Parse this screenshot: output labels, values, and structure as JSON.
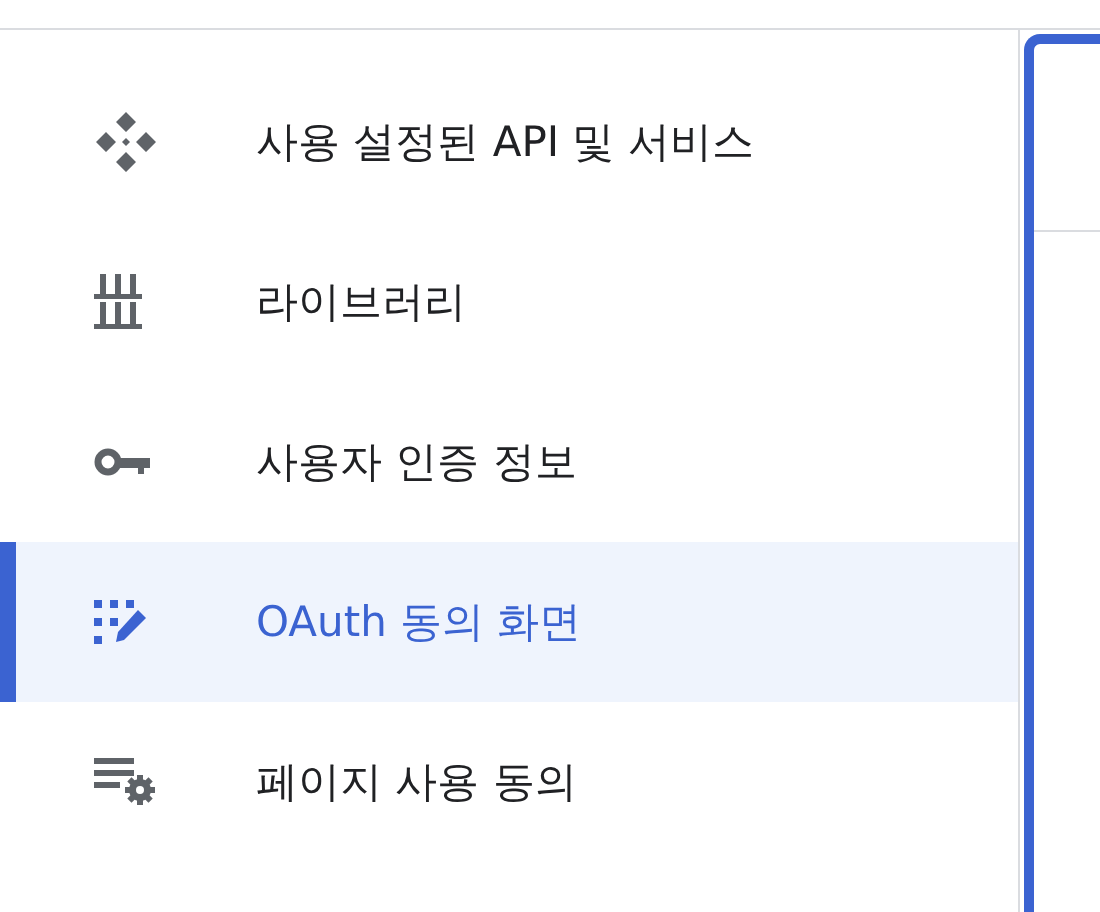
{
  "nav_items": [
    {
      "kind": "api",
      "label": "사용 설정된 API 및 서비스",
      "selected": false
    },
    {
      "kind": "library",
      "label": "라이브러리",
      "selected": false
    },
    {
      "kind": "key",
      "label": "사용자 인증 정보",
      "selected": false
    },
    {
      "kind": "consent",
      "label": "OAuth 동의 화면",
      "selected": true
    },
    {
      "kind": "settings",
      "label": "페이지 사용 동의",
      "selected": false
    }
  ]
}
